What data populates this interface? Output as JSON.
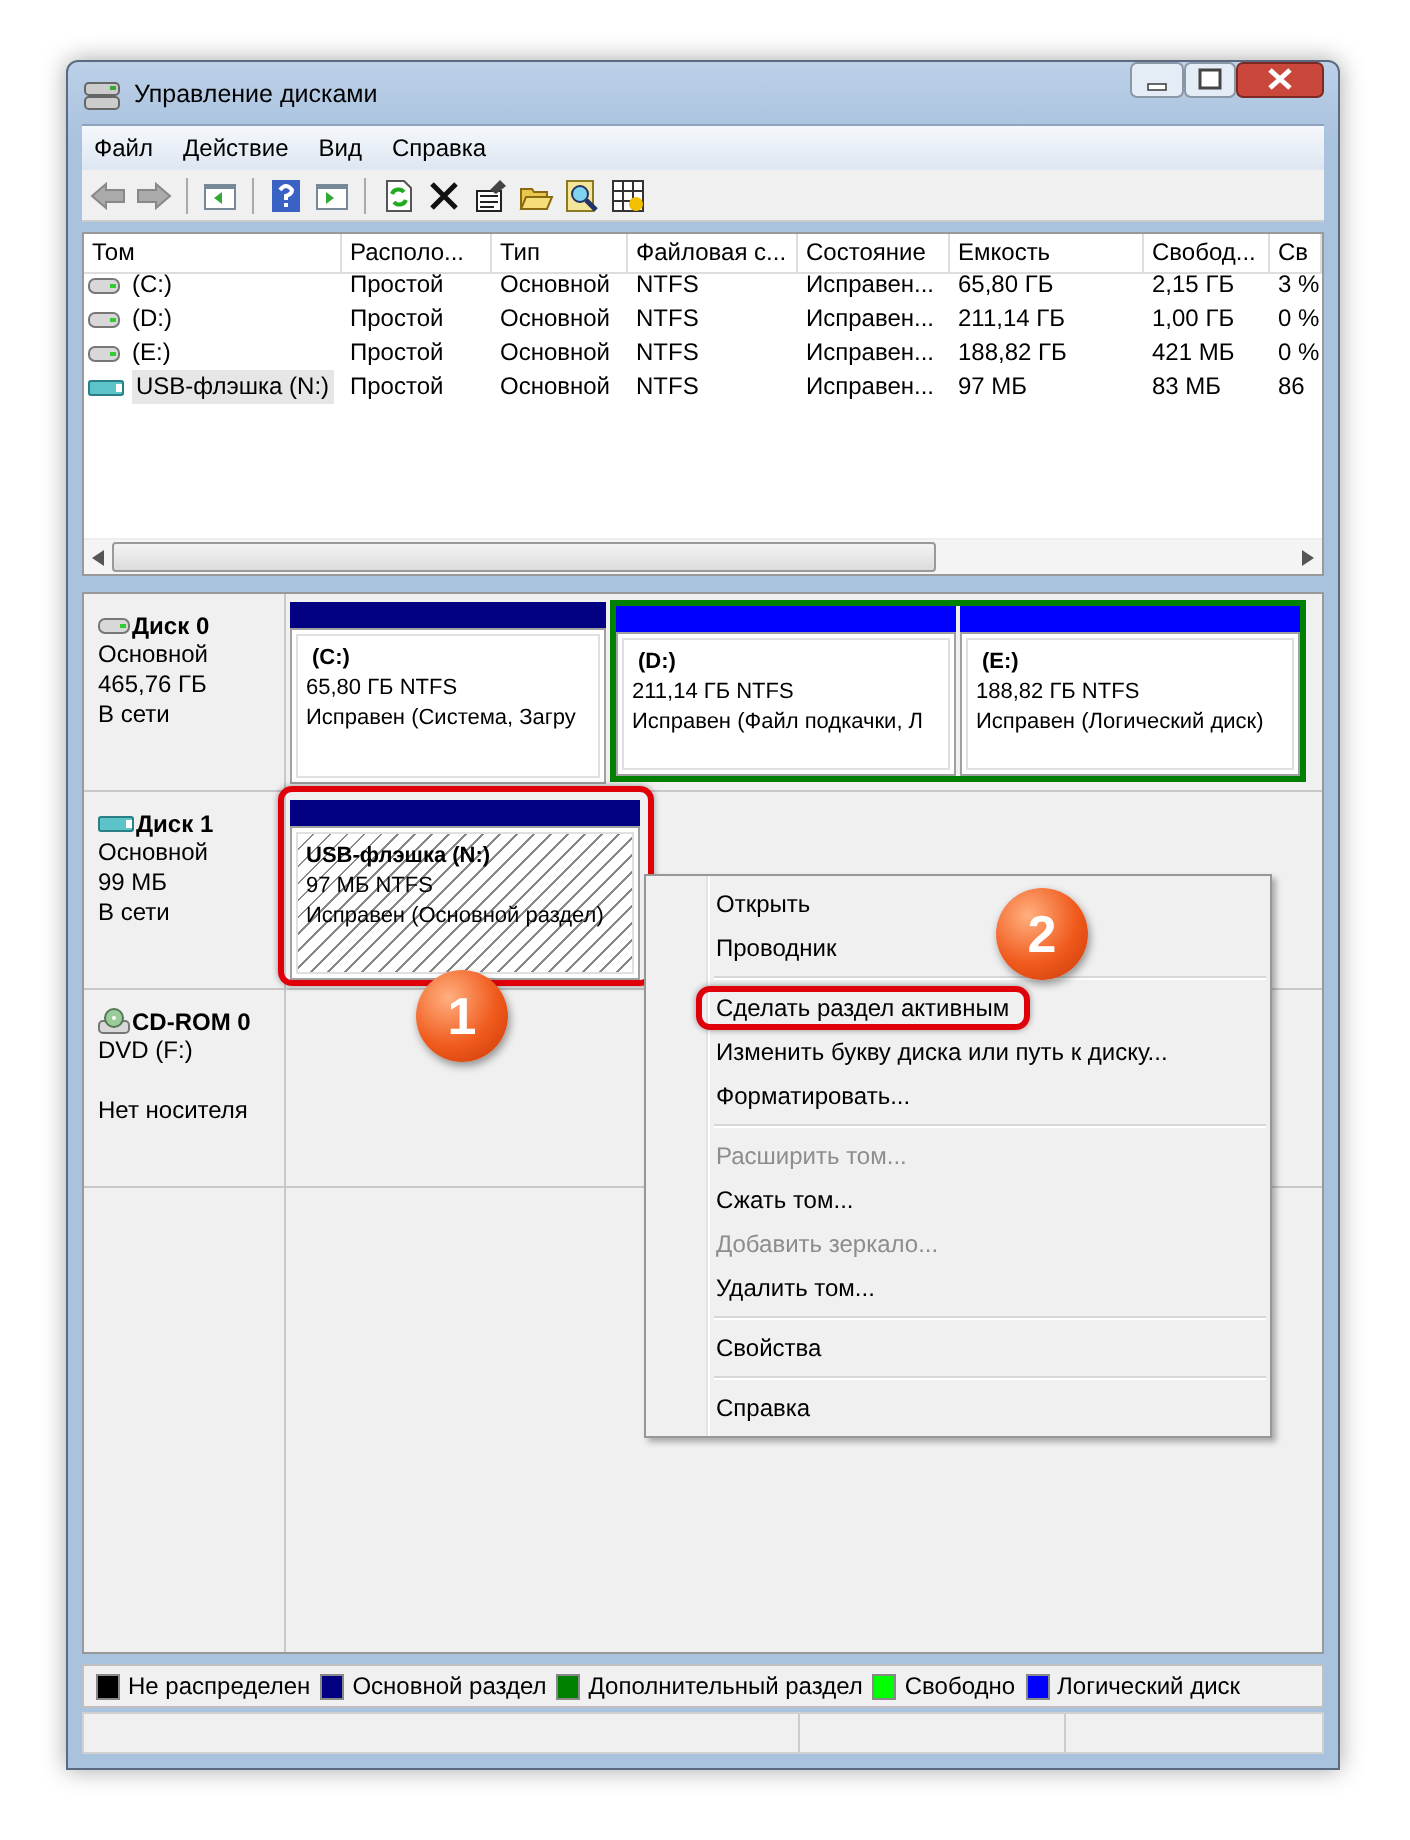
{
  "window": {
    "title": "Управление дисками"
  },
  "menu": [
    "Файл",
    "Действие",
    "Вид",
    "Справка"
  ],
  "table": {
    "columns": [
      "Том",
      "Располо...",
      "Тип",
      "Файловая с...",
      "Состояние",
      "Емкость",
      "Свобод...",
      "Св"
    ],
    "rows": [
      {
        "kind": "hdd",
        "selected": false,
        "cells": [
          "(C:)",
          "Простой",
          "Основной",
          "NTFS",
          "Исправен...",
          "65,80 ГБ",
          "2,15 ГБ",
          "3 %"
        ]
      },
      {
        "kind": "hdd",
        "selected": false,
        "cells": [
          "(D:)",
          "Простой",
          "Основной",
          "NTFS",
          "Исправен...",
          "211,14 ГБ",
          "1,00 ГБ",
          "0 %"
        ]
      },
      {
        "kind": "hdd",
        "selected": false,
        "cells": [
          "(E:)",
          "Простой",
          "Основной",
          "NTFS",
          "Исправен...",
          "188,82 ГБ",
          "421 МБ",
          "0 %"
        ]
      },
      {
        "kind": "usb",
        "selected": true,
        "cells": [
          "USB-флэшка (N:)",
          "Простой",
          "Основной",
          "NTFS",
          "Исправен...",
          "97 МБ",
          "83 МБ",
          "86"
        ]
      }
    ]
  },
  "disks": [
    {
      "kind": "hdd",
      "name": "Диск 0",
      "type": "Основной",
      "size": "465,76 ГБ",
      "status": "В сети",
      "partitions": [
        {
          "kind": "primary",
          "selected": false,
          "title": "(C:)",
          "size": "65,80 ГБ NTFS",
          "status": "Исправен (Система, Загру"
        },
        {
          "kind": "extended",
          "children": [
            {
              "kind": "logical",
              "selected": false,
              "title": "(D:)",
              "size": "211,14 ГБ NTFS",
              "status": "Исправен (Файл подкачки, Л"
            },
            {
              "kind": "logical",
              "selected": false,
              "title": "(E:)",
              "size": "188,82 ГБ NTFS",
              "status": "Исправен (Логический диск)"
            }
          ]
        }
      ]
    },
    {
      "kind": "usb",
      "name": "Диск 1",
      "type": "Основной",
      "size": "99 МБ",
      "status": "В сети",
      "partitions": [
        {
          "kind": "primary",
          "selected": true,
          "title": "USB-флэшка  (N:)",
          "size": "97 МБ NTFS",
          "status": "Исправен (Основной раздел)"
        }
      ]
    },
    {
      "kind": "cdrom",
      "name": "CD-ROM 0",
      "type": "DVD (F:)",
      "status": "Нет носителя"
    }
  ],
  "legend": [
    {
      "label": "Не распределен",
      "color": "#000000"
    },
    {
      "label": "Основной раздел",
      "color": "#000080"
    },
    {
      "label": "Дополнительный раздел",
      "color": "#008000"
    },
    {
      "label": "Свободно",
      "color": "#00ff00"
    },
    {
      "label": "Логический диск",
      "color": "#0000ff"
    }
  ],
  "context_menu": {
    "groups": [
      [
        {
          "label": "Открыть",
          "disabled": false
        },
        {
          "label": "Проводник",
          "disabled": false
        }
      ],
      [
        {
          "label": "Сделать раздел активным",
          "disabled": false,
          "annotated": true
        },
        {
          "label": "Изменить букву диска или путь к диску...",
          "disabled": false
        },
        {
          "label": "Форматировать...",
          "disabled": false
        }
      ],
      [
        {
          "label": "Расширить том...",
          "disabled": true
        },
        {
          "label": "Сжать том...",
          "disabled": false
        },
        {
          "label": "Добавить зеркало...",
          "disabled": true
        },
        {
          "label": "Удалить том...",
          "disabled": false
        }
      ],
      [
        {
          "label": "Свойства",
          "disabled": false
        }
      ],
      [
        {
          "label": "Справка",
          "disabled": false
        }
      ]
    ]
  },
  "callouts": [
    {
      "label": "1"
    },
    {
      "label": "2"
    }
  ]
}
